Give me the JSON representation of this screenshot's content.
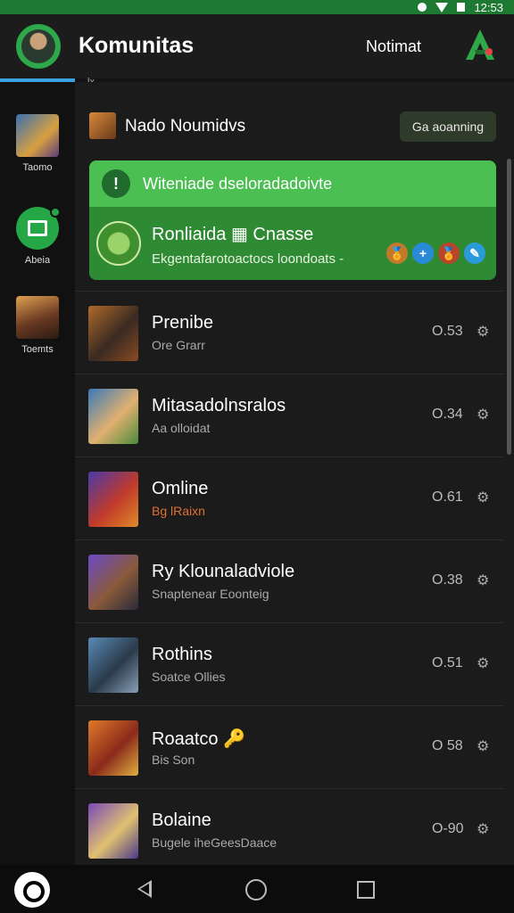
{
  "status": {
    "time": "12:53"
  },
  "header": {
    "title": "Komunitas",
    "notif_label": "Notimat",
    "tab_small": "lx",
    "logo_icon": "green-a-logo-icon"
  },
  "sidebar": {
    "items": [
      {
        "label": "Taomo",
        "icon": "game-thumb-icon"
      },
      {
        "label": "Abeia",
        "icon": "chat-icon"
      },
      {
        "label": "Toemts",
        "icon": "game-thumb-icon"
      }
    ]
  },
  "section": {
    "label": "Nado Noumidvs",
    "button": "Ga aoanning"
  },
  "banner": {
    "alert_text": "Witeniade dseloradadoivte",
    "title": "Ronliaida ▦ Cnasse",
    "subtitle": "Ekgentafarotoactocs loondoats -",
    "badges": [
      "🏅",
      "+",
      "🏅",
      "✎"
    ]
  },
  "list": {
    "rows": [
      {
        "name": "Prenibe",
        "sub": "Ore Grarr",
        "value": "O.53"
      },
      {
        "name": "Mitasadolnsralos",
        "sub": "Aa olloidat",
        "value": "O.34"
      },
      {
        "name": "Omline",
        "sub": "Bg lRaixn",
        "value": "O.61"
      },
      {
        "name": "Ry Klounaladviole",
        "sub": "Snaptenear Eoonteig",
        "value": "O.38"
      },
      {
        "name": "Rothins",
        "sub": "Soatce Ollies",
        "value": "O.51"
      },
      {
        "name": "Roaatco 🔑",
        "sub": "Bis Son",
        "value": "O 58"
      },
      {
        "name": "Bolaine",
        "sub": "Bugele iheGeesDaace",
        "value": "O-90"
      }
    ]
  },
  "colors": {
    "accent": "#2da84a",
    "banner": "#3fae4a",
    "bg": "#1b1b1b"
  }
}
